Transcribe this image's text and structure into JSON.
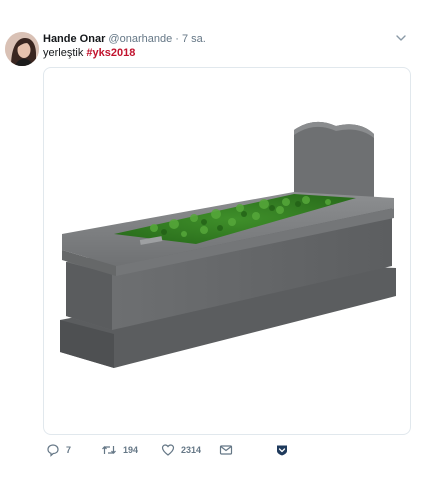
{
  "tweet": {
    "author_name": "Hande Onar",
    "handle": "@onarhande",
    "separator": "·",
    "time": "7 sa.",
    "text": "yerleştik",
    "hashtag": "#yks2018",
    "avatar_icon": "user-avatar-photo",
    "media_icon": "gravestone-photo",
    "hashtag_color": "#c1122d"
  },
  "actions": {
    "reply": {
      "icon": "reply-icon",
      "count": "7"
    },
    "retweet": {
      "icon": "retweet-icon",
      "count": "194"
    },
    "like": {
      "icon": "heart-icon",
      "count": "2314"
    },
    "dm": {
      "icon": "envelope-icon"
    },
    "extra": {
      "icon": "shield-icon"
    }
  }
}
